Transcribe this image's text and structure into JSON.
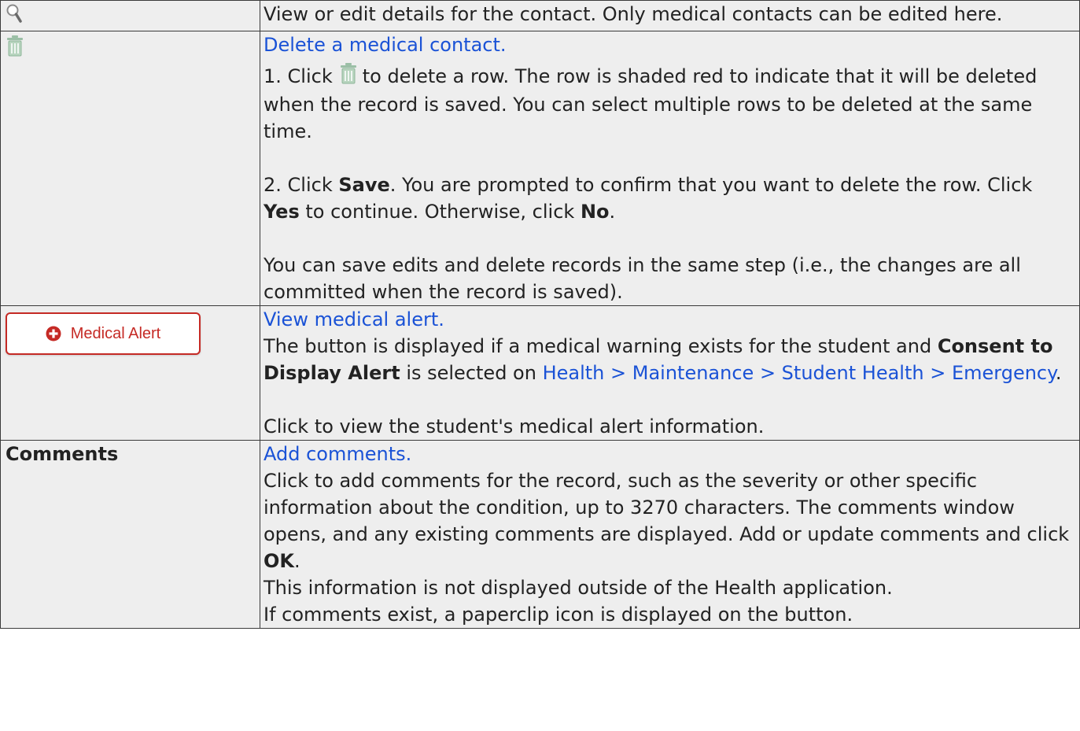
{
  "icons": {
    "magnifier": "magnifier-icon",
    "trash": "trash-icon",
    "plus_circle": "plus-circle-icon"
  },
  "colors": {
    "link": "#1a52d6",
    "alert": "#c52a25",
    "trash": "#9bbfa6",
    "cell_bg": "#eeeeee"
  },
  "rows": {
    "view": {
      "desc": "View or edit details for the contact. Only medical contacts can be edited here."
    },
    "delete": {
      "link": "Delete a medical contact.",
      "step1_a": "1. Click",
      "step1_b": "to delete a row. The row is shaded red to indicate that it will be deleted when the record is saved. You can select multiple rows to be deleted at the same time.",
      "step2_a": "2. Click ",
      "step2_save": "Save",
      "step2_b": ". You are prompted to confirm that you want to delete the row. Click ",
      "step2_yes": "Yes",
      "step2_c": " to continue. Otherwise, click ",
      "step2_no": "No",
      "step2_d": ".",
      "note": "You can save edits and delete records in the same step (i.e., the changes are all committed when the record is saved)."
    },
    "alert": {
      "button_label": "Medical Alert",
      "link": "View medical alert.",
      "desc_a": "The button is displayed if a medical warning exists for the student and ",
      "desc_bold": "Consent to Display Alert",
      "desc_b": " is selected on ",
      "desc_link": "Health > Maintenance > Student Health > Emergency",
      "desc_c": ".",
      "click": "Click to view the student's medical alert information."
    },
    "comments": {
      "label": "Comments",
      "link": "Add comments.",
      "desc_a": "Click to add comments for the record, such as the severity or other specific information about the condition, up to 3270 characters. The comments window opens, and any existing comments are displayed. Add or update comments and click ",
      "desc_ok": "OK",
      "desc_b": ".",
      "line2": "This information is not displayed outside of the Health application.",
      "line3": "If comments exist, a paperclip icon is displayed on the button."
    }
  }
}
